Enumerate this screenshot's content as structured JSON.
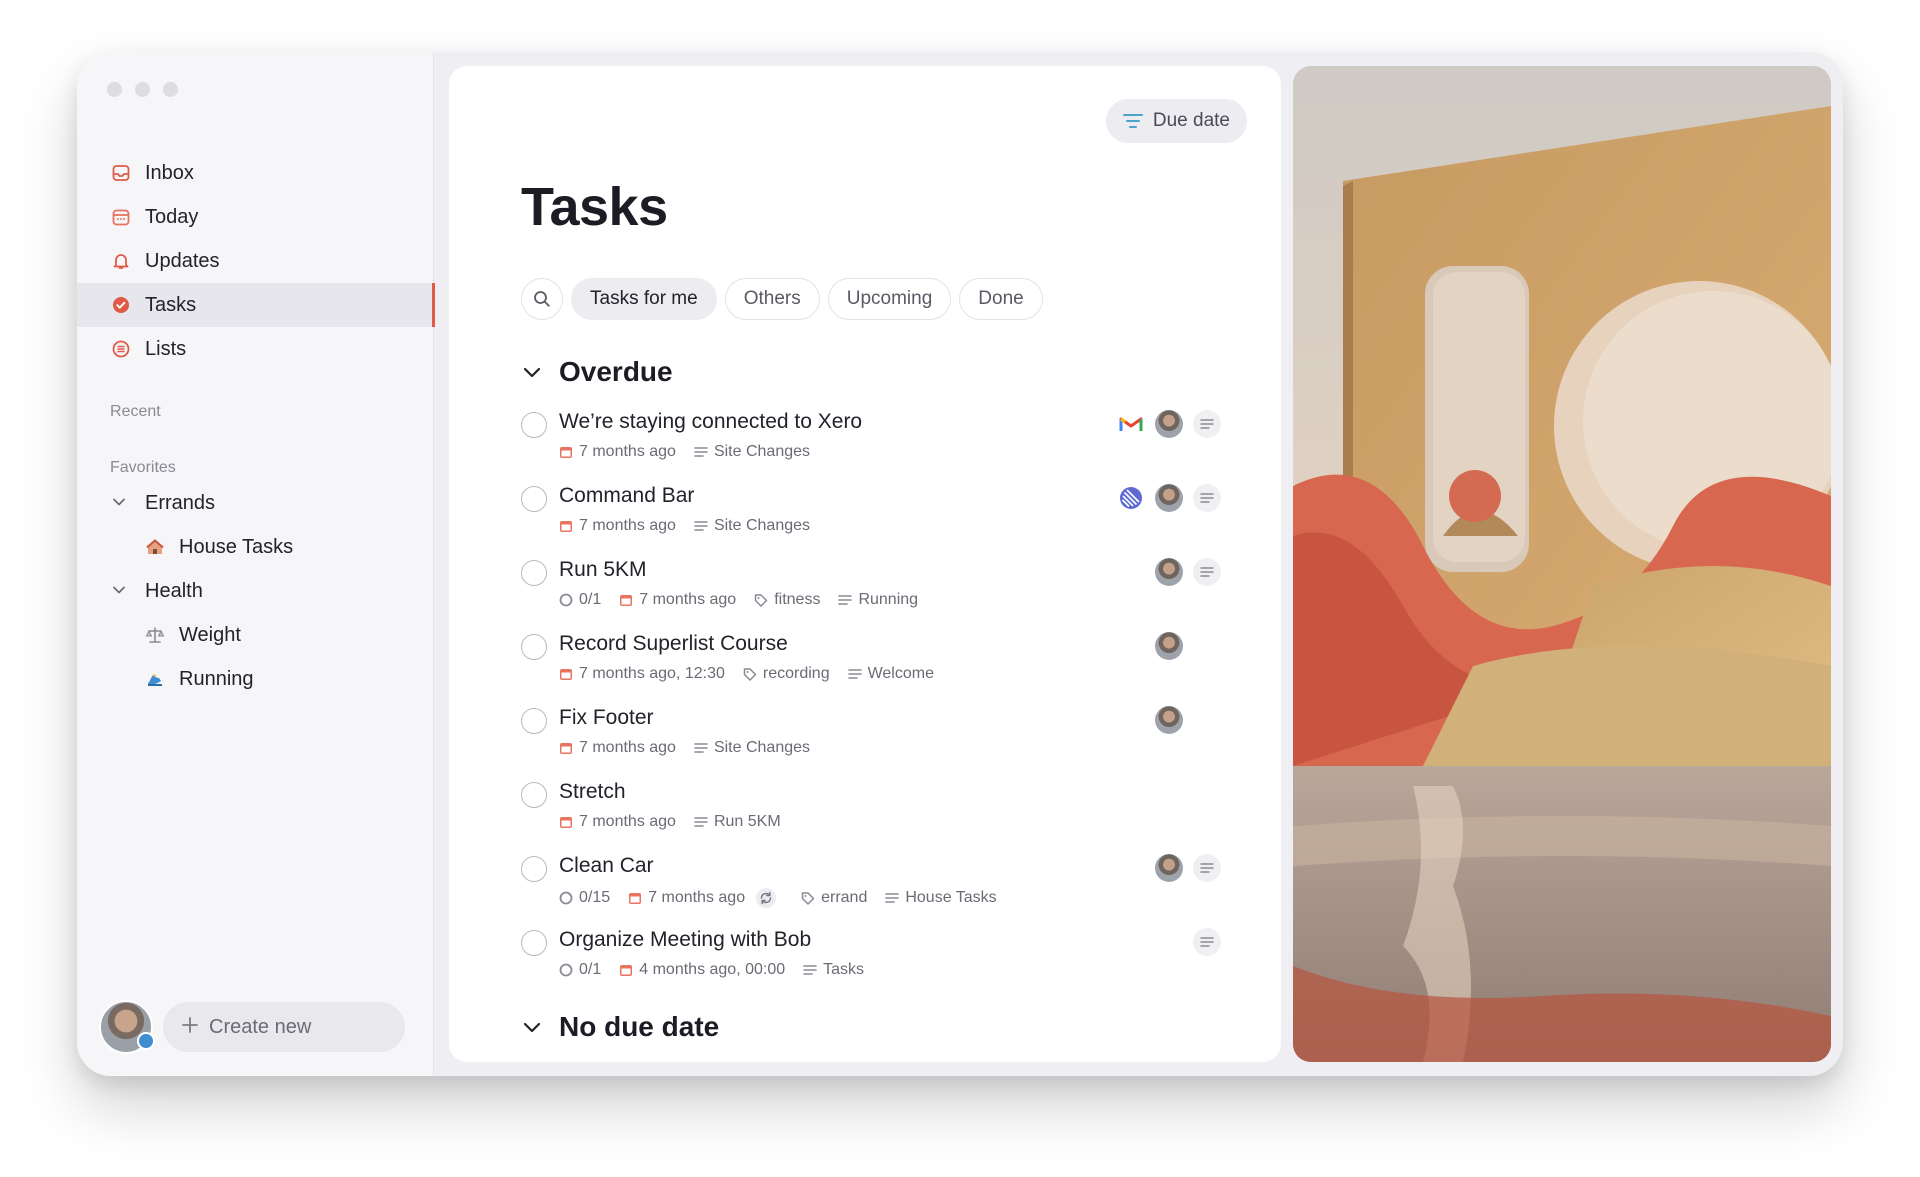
{
  "sidebar": {
    "nav": [
      {
        "label": "Inbox",
        "icon": "inbox-icon"
      },
      {
        "label": "Today",
        "icon": "calendar-icon"
      },
      {
        "label": "Updates",
        "icon": "bell-icon"
      },
      {
        "label": "Tasks",
        "icon": "check-circle-icon",
        "active": true
      },
      {
        "label": "Lists",
        "icon": "list-icon"
      }
    ],
    "recent_label": "Recent",
    "favorites_label": "Favorites",
    "favorites": [
      {
        "label": "Errands",
        "children": [
          {
            "label": "House Tasks",
            "icon": "house-icon"
          }
        ]
      },
      {
        "label": "Health",
        "children": [
          {
            "label": "Weight",
            "icon": "scale-icon"
          },
          {
            "label": "Running",
            "icon": "running-icon"
          }
        ]
      }
    ],
    "create_new": "Create new"
  },
  "main": {
    "sort_button": "Due date",
    "title": "Tasks",
    "filters": [
      "Tasks for me",
      "Others",
      "Upcoming",
      "Done"
    ],
    "active_filter": "Tasks for me",
    "sections": [
      {
        "title": "Overdue",
        "tasks": [
          {
            "name": "We’re staying connected to Xero",
            "date": "7 months ago",
            "list": "Site Changes",
            "icons": [
              "gmail-icon",
              "avatar",
              "notes-icon"
            ]
          },
          {
            "name": "Command Bar",
            "date": "7 months ago",
            "list": "Site Changes",
            "icons": [
              "linear-icon",
              "avatar",
              "notes-icon"
            ]
          },
          {
            "name": "Run 5KM",
            "progress": "0/1",
            "date": "7 months ago",
            "tag": "fitness",
            "list": "Running",
            "icons": [
              "avatar",
              "notes-icon"
            ]
          },
          {
            "name": "Record Superlist Course",
            "date": "7 months ago, 12:30",
            "tag": "recording",
            "list": "Welcome",
            "icons": [
              "avatar"
            ]
          },
          {
            "name": "Fix Footer",
            "date": "7 months ago",
            "list": "Site Changes",
            "icons": [
              "avatar"
            ]
          },
          {
            "name": "Stretch",
            "date": "7 months ago",
            "list": "Run 5KM",
            "icons": []
          },
          {
            "name": "Clean Car",
            "progress": "0/15",
            "date": "7 months ago",
            "repeat": true,
            "tag": "errand",
            "list": "House Tasks",
            "icons": [
              "avatar",
              "notes-icon"
            ]
          },
          {
            "name": "Organize Meeting with Bob",
            "progress": "0/1",
            "date": "4 months ago, 00:00",
            "list": "Tasks",
            "icons": [
              "notes-icon"
            ]
          }
        ]
      },
      {
        "title": "No due date",
        "tasks": []
      }
    ]
  },
  "colors": {
    "accent": "#e05a47",
    "date_icon": "#e8735f",
    "sort_icon": "#4aa3c8"
  }
}
